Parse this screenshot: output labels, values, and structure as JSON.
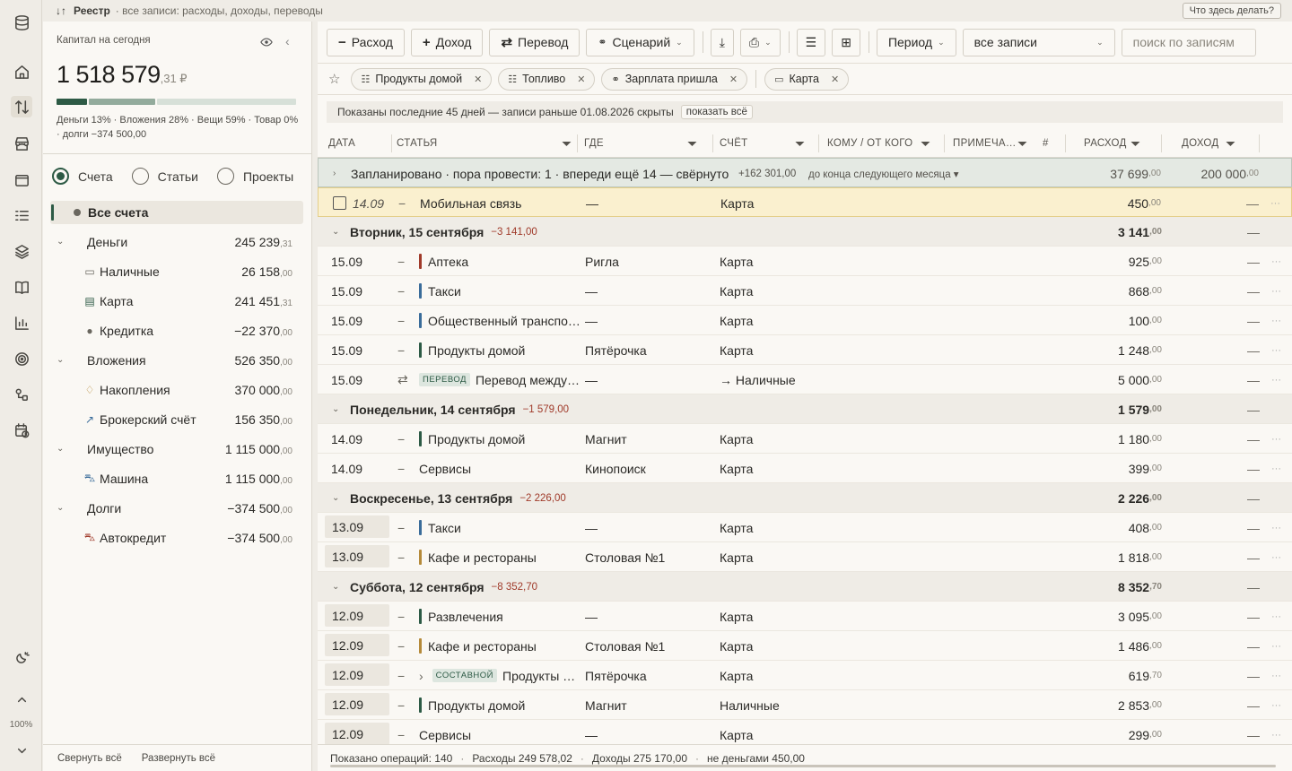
{
  "topbar": {
    "title": "Реестр",
    "subtitle": "· все записи: расходы, доходы, переводы",
    "help": "Что здесь делать?"
  },
  "rail": {
    "zoom": "100%",
    "icons": [
      "database-icon",
      "home-icon",
      "transfer-icon",
      "store-icon",
      "wallet-icon",
      "list-icon",
      "layers-icon",
      "book-icon",
      "chart-icon",
      "target-icon",
      "nodes-icon",
      "calendar-clock-icon",
      "theme-icon",
      "up-icon",
      "down-icon"
    ]
  },
  "capital": {
    "label": "Капитал на сегодня",
    "value": "1 518 579",
    "cents": ",31 ₽",
    "legend": "Деньги 13% · Вложения 28% · Вещи 59% · Товар 0% · долги −374 500,00",
    "bar": [
      {
        "pct": 13,
        "color": "#2d5a45"
      },
      {
        "pct": 28,
        "color": "#93ab9c"
      },
      {
        "pct": 59,
        "color": "#d7e0d8"
      }
    ]
  },
  "modes": [
    "Счета",
    "Статьи",
    "Проекты"
  ],
  "all_accounts": "Все счета",
  "accounts": [
    {
      "name": "Деньги",
      "amt": "245 239",
      "c": ",31",
      "level": 0
    },
    {
      "name": "Наличные",
      "amt": "26 158",
      "c": ",00",
      "level": 1,
      "icon": "cash-icon"
    },
    {
      "name": "Карта",
      "amt": "241 451",
      "c": ",31",
      "level": 1,
      "icon": "card-icon"
    },
    {
      "name": "Кредитка",
      "amt": "−22 370",
      "c": ",00",
      "level": 1,
      "icon": "dot-icon"
    },
    {
      "name": "Вложения",
      "amt": "526 350",
      "c": ",00",
      "level": 0
    },
    {
      "name": "Накопления",
      "amt": "370 000",
      "c": ",00",
      "level": 1,
      "icon": "piggy-icon"
    },
    {
      "name": "Брокерский счёт",
      "amt": "156 350",
      "c": ",00",
      "level": 1,
      "icon": "trend-icon"
    },
    {
      "name": "Имущество",
      "amt": "1 115 000",
      "c": ",00",
      "level": 0
    },
    {
      "name": "Машина",
      "amt": "1 115 000",
      "c": ",00",
      "level": 1,
      "icon": "car-icon"
    },
    {
      "name": "Долги",
      "amt": "−374 500",
      "c": ",00",
      "level": 0
    },
    {
      "name": "Автокредит",
      "amt": "−374 500",
      "c": ",00",
      "level": 1,
      "icon": "car-red-icon"
    }
  ],
  "side_footer": {
    "collapse": "Свернуть всё",
    "expand": "Развернуть всё"
  },
  "toolbar": {
    "expense": "Расход",
    "income": "Доход",
    "transfer": "Перевод",
    "scenario": "Сценарий",
    "period": "Период",
    "records": "все записи",
    "search_placeholder": "поиск по записям"
  },
  "filters": [
    {
      "label": "Продукты домой",
      "icon": "list-icon"
    },
    {
      "label": "Топливо",
      "icon": "list-icon"
    },
    {
      "label": "Зарплата пришла",
      "icon": "scenario-icon"
    }
  ],
  "account_filter": "Карта",
  "banner": {
    "text": "Показаны последние 45 дней — записи раньше 01.08.2026 скрыты",
    "show_all": "показать всё"
  },
  "columns": [
    "ДАТА",
    "СТАТЬЯ",
    "ГДЕ",
    "СЧЁТ",
    "КОМУ / ОТ КОГО",
    "ПРИМЕЧА…",
    "#",
    "РАСХОД",
    "ДОХОД"
  ],
  "planned": {
    "title": "Запланировано · пора провести: 1 · впереди ещё 14 — свёрнуто",
    "sum": "+162 301,00",
    "range": "до конца следующего месяца ▾",
    "exp": "37 699",
    "exp_c": ",00",
    "inc": "200 000",
    "inc_c": ",00"
  },
  "rows": [
    {
      "type": "highlight",
      "date": "14.09",
      "cat": "Мобильная связь",
      "where": "—",
      "acct": "Карта",
      "exp": "450",
      "c": ",00"
    },
    {
      "type": "group",
      "title": "Вторник, 15 сентября",
      "delta": "−3 141,00",
      "total": "3 141",
      "c": ",00"
    },
    {
      "date": "15.09",
      "cat": "Аптека",
      "mk": "#a03a2a",
      "where": "Ригла",
      "acct": "Карта",
      "exp": "925",
      "c": ",00"
    },
    {
      "date": "15.09",
      "cat": "Такси",
      "mk": "#3a6c9a",
      "where": "—",
      "acct": "Карта",
      "exp": "868",
      "c": ",00"
    },
    {
      "date": "15.09",
      "cat": "Общественный транспо…",
      "mk": "#3a6c9a",
      "where": "—",
      "acct": "Карта",
      "exp": "100",
      "c": ",00"
    },
    {
      "date": "15.09",
      "cat": "Продукты домой",
      "mk": "#2d5a45",
      "where": "Пятёрочка",
      "acct": "Карта",
      "exp": "1 248",
      "c": ",00"
    },
    {
      "date": "15.09",
      "type": "transfer",
      "tag": "ПЕРЕВОД",
      "cat": "Перевод между…",
      "where": "—",
      "acct": "→ Наличные",
      "exp": "5 000",
      "c": ",00"
    },
    {
      "type": "group",
      "title": "Понедельник, 14 сентября",
      "delta": "−1 579,00",
      "total": "1 579",
      "c": ",00"
    },
    {
      "date": "14.09",
      "cat": "Продукты домой",
      "mk": "#2d5a45",
      "where": "Магнит",
      "acct": "Карта",
      "exp": "1 180",
      "c": ",00"
    },
    {
      "date": "14.09",
      "cat": "Сервисы",
      "where": "Кинопоиск",
      "acct": "Карта",
      "exp": "399",
      "c": ",00"
    },
    {
      "type": "group",
      "title": "Воскресенье, 13 сентября",
      "delta": "−2 226,00",
      "total": "2 226",
      "c": ",00"
    },
    {
      "date": "13.09",
      "box": true,
      "cat": "Такси",
      "mk": "#3a6c9a",
      "where": "—",
      "acct": "Карта",
      "exp": "408",
      "c": ",00"
    },
    {
      "date": "13.09",
      "box": true,
      "cat": "Кафе и рестораны",
      "mk": "#b58a3a",
      "where": "Столовая №1",
      "acct": "Карта",
      "exp": "1 818",
      "c": ",00"
    },
    {
      "type": "group",
      "title": "Суббота, 12 сентября",
      "delta": "−8 352,70",
      "total": "8 352",
      "c": ",70"
    },
    {
      "date": "12.09",
      "box": true,
      "cat": "Развлечения",
      "mk": "#2d5a45",
      "where": "—",
      "acct": "Карта",
      "exp": "3 095",
      "c": ",00"
    },
    {
      "date": "12.09",
      "box": true,
      "cat": "Кафе и рестораны",
      "mk": "#b58a3a",
      "where": "Столовая №1",
      "acct": "Карта",
      "exp": "1 486",
      "c": ",00"
    },
    {
      "date": "12.09",
      "box": true,
      "type": "composite",
      "tag": "СОСТАВНОЙ",
      "cat": "Продукты …",
      "where": "Пятёрочка",
      "acct": "Карта",
      "exp": "619",
      "c": ",70"
    },
    {
      "date": "12.09",
      "box": true,
      "cat": "Продукты домой",
      "mk": "#2d5a45",
      "where": "Магнит",
      "acct": "Наличные",
      "exp": "2 853",
      "c": ",00"
    },
    {
      "date": "12.09",
      "box": true,
      "cat": "Сервисы",
      "where": "—",
      "acct": "Карта",
      "exp": "299",
      "c": ",00"
    }
  ],
  "footer": {
    "shown": "Показано операций: 140",
    "expenses": "Расходы 249 578,02",
    "income": "Доходы 275 170,00",
    "non_money": "не деньгами 450,00"
  }
}
